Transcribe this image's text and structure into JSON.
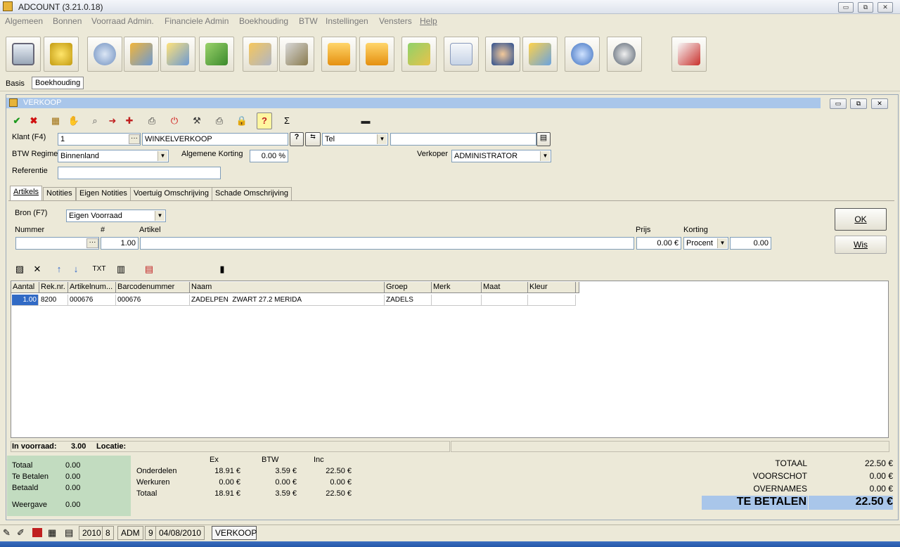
{
  "window": {
    "title": "ADCOUNT (3.21.0.18)",
    "min": "▭",
    "max": "⧉",
    "close": "✕"
  },
  "menu": [
    "Algemeen",
    "Bonnen",
    "Voorraad Admin.",
    "Financiele Admin",
    "Boekhouding",
    "BTW",
    "Instellingen",
    "Vensters",
    "Help"
  ],
  "toolbar_icons": [
    "cart-icon",
    "coins-icon",
    "gear-icon",
    "gear-monitor-icon",
    "bulb-monitor-icon",
    "book-icon",
    "box-icon",
    "keys-icon",
    "import-arrow-icon",
    "export-arrow-icon",
    "folder-download-icon",
    "download-window-icon",
    "user-icon",
    "truck-icon",
    "lightbulb-icon",
    "speaker-icon",
    "info-document-icon"
  ],
  "subtabs": {
    "basis": "Basis",
    "boekhouding": "Boekhouding"
  },
  "inner": {
    "title": "VERKOOP"
  },
  "form": {
    "klant_label": "Klant (F4)",
    "klant_nr": "1",
    "klant_naam": "WINKELVERKOOP",
    "tel_option": "Tel",
    "btw_label": "BTW Regime",
    "btw_value": "Binnenland",
    "korting_label": "Algemene Korting",
    "korting_value": "0.00 %",
    "verkoper_label": "Verkoper",
    "verkoper_value": "ADMINISTRATOR",
    "referentie_label": "Referentie"
  },
  "tabs": [
    "Artikels",
    "Notities",
    "Eigen Notities",
    "Voertuig Omschrijving",
    "Schade Omschrijving"
  ],
  "article": {
    "bron_label": "Bron (F7)",
    "bron_value": "Eigen Voorraad",
    "nummer_label": "Nummer",
    "qty_label": "#",
    "artikel_label": "Artikel",
    "prijs_label": "Prijs",
    "korting_label": "Korting",
    "qty_value": "1.00",
    "prijs_value": "0.00 €",
    "korting_type": "Procent",
    "korting_value": "0.00",
    "ok_label": "OK",
    "wis_label": "Wis",
    "txt_label": "TXT"
  },
  "grid": {
    "columns": [
      "Aantal",
      "Rek.nr.",
      "Artikelnum...",
      "Barcodenummer",
      "Naam",
      "Groep",
      "Merk",
      "Maat",
      "Kleur"
    ],
    "rows": [
      [
        "1.00",
        "8200",
        "000676",
        "000676",
        "ZADELPEN  ZWART 27.2 MERIDA",
        "ZADELS",
        "",
        "",
        ""
      ]
    ]
  },
  "stock": {
    "voorraad_label": "In voorraad:",
    "voorraad_value": "3.00",
    "locatie_label": "Locatie:"
  },
  "summary": {
    "totaal_label": "Totaal",
    "totaal_value": "0.00",
    "te_betalen_label": "Te Betalen",
    "te_betalen_value": "0.00",
    "betaald_label": "Betaald",
    "betaald_value": "0.00",
    "weergave_label": "Weergave",
    "weergave_value": "0.00"
  },
  "breakdown": {
    "headers": [
      "Ex",
      "BTW",
      "Inc"
    ],
    "rows": [
      {
        "label": "Onderdelen",
        "ex": "18.91 €",
        "btw": "3.59 €",
        "inc": "22.50 €"
      },
      {
        "label": "Werkuren",
        "ex": "0.00 €",
        "btw": "0.00 €",
        "inc": "0.00 €"
      },
      {
        "label": "Totaal",
        "ex": "18.91 €",
        "btw": "3.59 €",
        "inc": "22.50 €"
      }
    ]
  },
  "totals": {
    "totaal_label": "TOTAAL",
    "totaal_value": "22.50 €",
    "voorschot_label": "VOORSCHOT",
    "voorschot_value": "0.00 €",
    "overnames_label": "OVERNAMES",
    "overnames_value": "0.00 €",
    "te_betalen_label": "TE BETALEN",
    "te_betalen_value": "22.50 €"
  },
  "status": {
    "year": "2010",
    "period": "8",
    "user": "ADM",
    "num": "9",
    "date": "04/08/2010",
    "mode": "VERKOOP"
  },
  "colors": {
    "accent": "#a9c6ea",
    "green_panel": "#c2dcc0",
    "te_betalen_bg": "#a9c6ea"
  }
}
